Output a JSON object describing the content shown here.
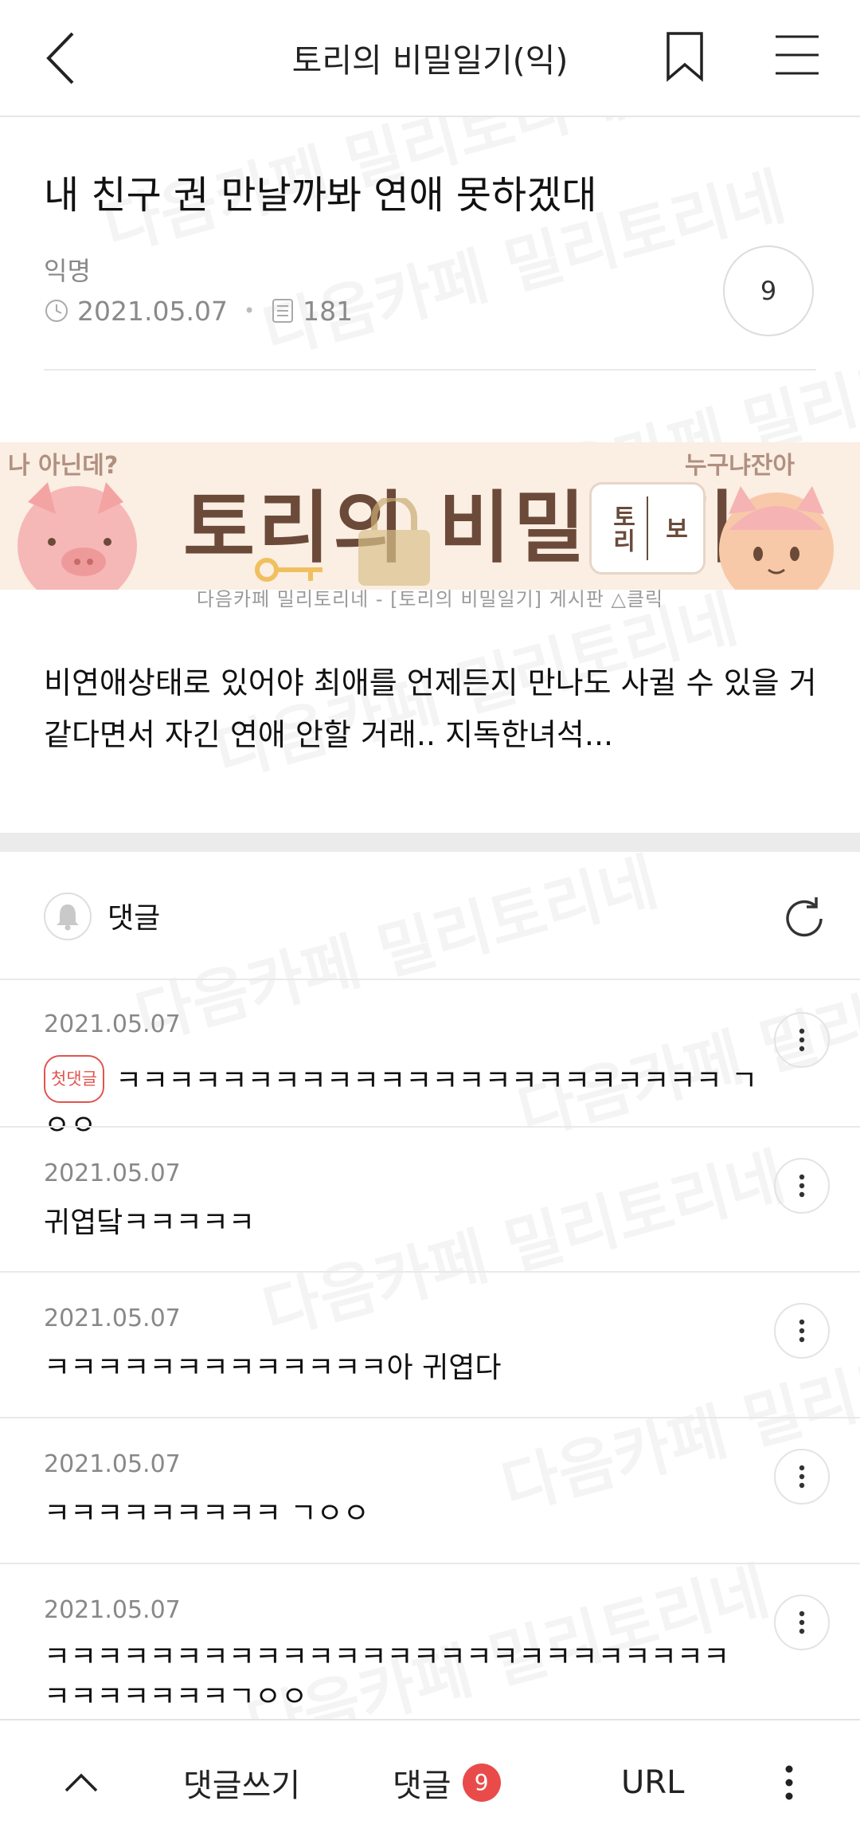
{
  "header": {
    "title": "토리의 비밀일기(익)",
    "back_icon": "back-arrow-icon",
    "bookmark_icon": "bookmark-icon",
    "menu_icon": "hamburger-menu-icon"
  },
  "post": {
    "title": "내 친구 권 만날까봐 연애 못하겠대",
    "author": "익명",
    "date": "2021.05.07",
    "views": "181",
    "comment_count": "9",
    "body": "비연애상태로 있어야 최애를 언제든지 만나도 사귈 수 있을 거 같다면서 자긴 연애 안할 거래.. 지독한녀석..."
  },
  "banner": {
    "left_small": "나 아닌데?",
    "right_small": "누구냐잔아",
    "title": "토리의 비밀일기",
    "badge_left": "토리",
    "badge_right": "보",
    "caption": "다음카페 밀리토리네 - [토리의 비밀일기] 게시판 △클릭"
  },
  "comments_section": {
    "label": "댓글",
    "comments": [
      {
        "date": "2021.05.07",
        "badge": "첫댓글",
        "text": "ㅋㅋㅋㅋㅋㅋㅋㅋㅋㅋㅋㅋㅋㅋㅋㅋㅋㅋㅋㅋㅋㅋㅋ ㄱㅇㅇ"
      },
      {
        "date": "2021.05.07",
        "text": "귀엽닼ㅋㅋㅋㅋㅋ"
      },
      {
        "date": "2021.05.07",
        "text": "ㅋㅋㅋㅋㅋㅋㅋㅋㅋㅋㅋㅋㅋ아 귀엽다"
      },
      {
        "date": "2021.05.07",
        "text": "ㅋㅋㅋㅋㅋㅋㅋㅋㅋ ㄱㅇㅇ"
      },
      {
        "date": "2021.05.07",
        "text": "ㅋㅋㅋㅋㅋㅋㅋㅋㅋㅋㅋㅋㅋㅋㅋㅋㅋㅋㅋㅋㅋㅋㅋㅋㅋㅋㅋㅋㅋㅋㅋㅋㅋㄱㅇㅇ"
      }
    ]
  },
  "bottom_bar": {
    "write_comment": "댓글쓰기",
    "comments_label": "댓글",
    "comments_count": "9",
    "url_label": "URL"
  },
  "watermark": "다음카페 밀리토리네",
  "colors": {
    "accent_red": "#e94b4b",
    "first_badge": "#e0554e"
  }
}
